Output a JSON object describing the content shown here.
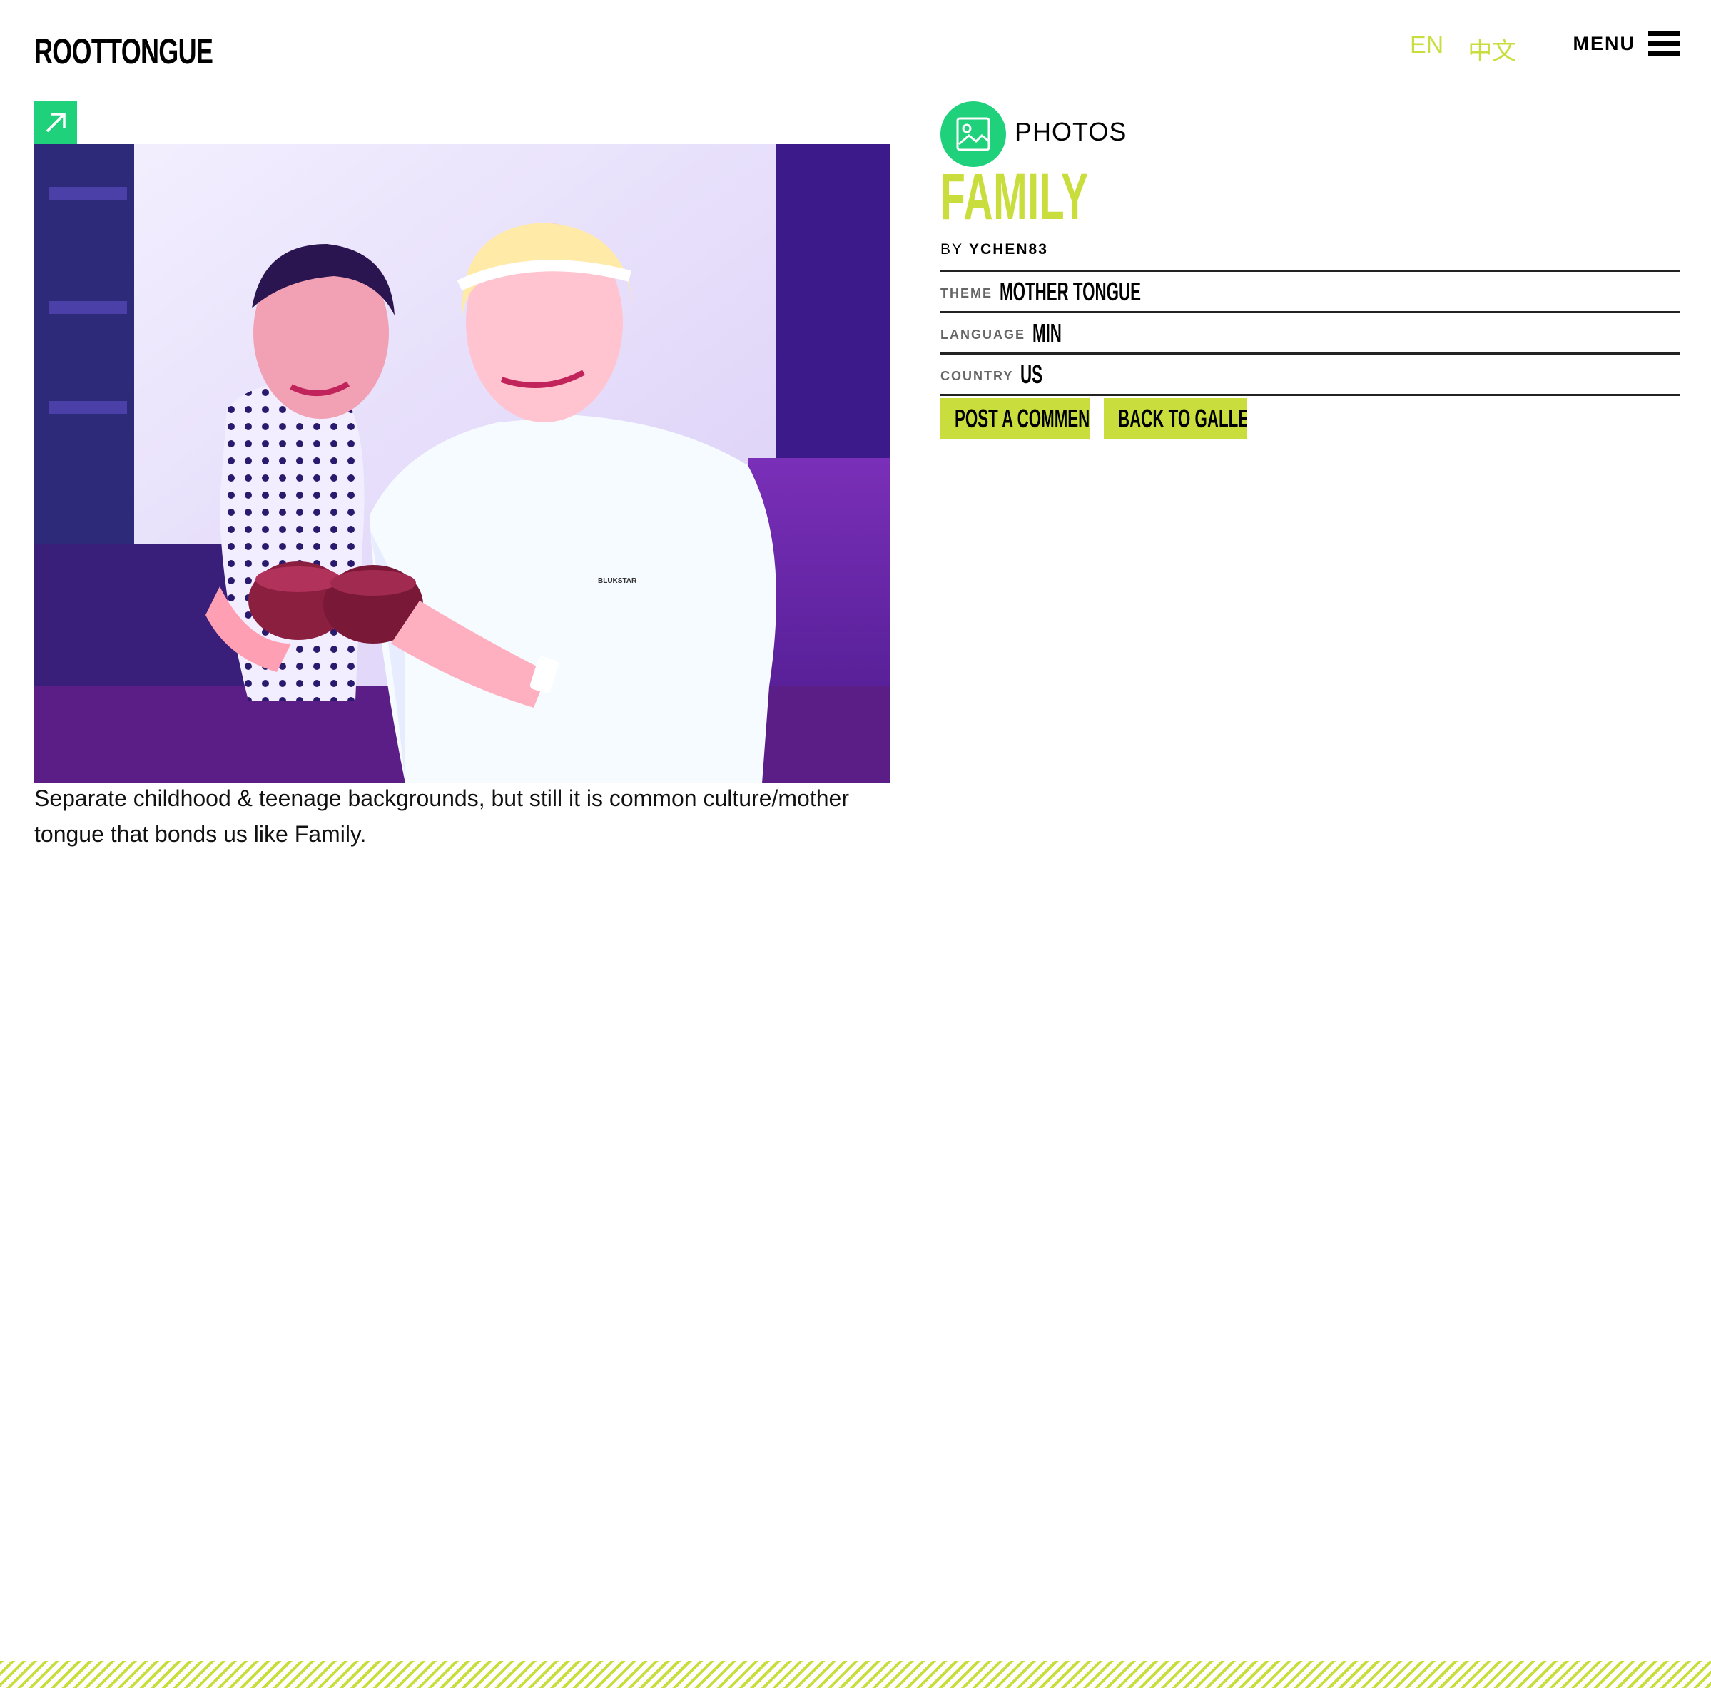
{
  "header": {
    "logo": "ROOTTONGUE",
    "languages": [
      "EN",
      "中文"
    ],
    "menu_label": "MENU"
  },
  "post": {
    "type_label": "PHOTOS",
    "title": "FAMILY",
    "by_label": "BY",
    "author": "YCHEN83",
    "meta": [
      {
        "key": "THEME",
        "value": "MOTHER TONGUE"
      },
      {
        "key": "LANGUAGE",
        "value": "MIN"
      },
      {
        "key": "COUNTRY",
        "value": "US"
      }
    ],
    "caption": "Separate childhood & teenage backgrounds, but still it is common culture/mother tongue that bonds us like Family.",
    "shirt_text": "BLUKSTAR"
  },
  "actions": {
    "comment": "POST A COMMENT",
    "back": "BACK TO GALLERY"
  },
  "colors": {
    "accent_lime": "#c9de3c",
    "accent_green": "#1fd17a"
  }
}
